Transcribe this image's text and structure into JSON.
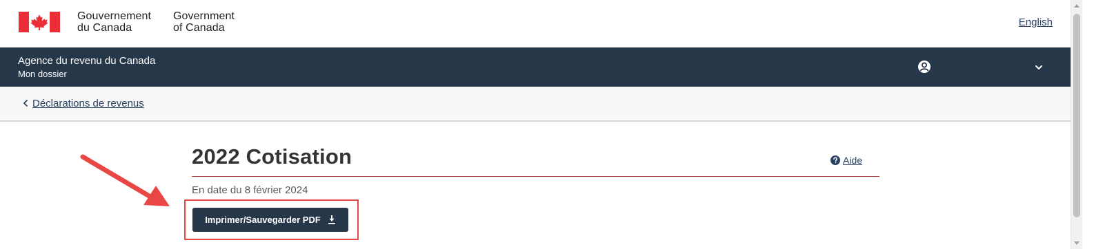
{
  "header": {
    "wordmark_fr_line1": "Gouvernement",
    "wordmark_fr_line2": "du Canada",
    "wordmark_en_line1": "Government",
    "wordmark_en_line2": "of Canada",
    "language_link": "English",
    "flag_icon": "canada-flag-icon"
  },
  "app_bar": {
    "title": "Agence du revenu du Canada",
    "subtitle": "Mon dossier",
    "account_icon": "account-circle-icon",
    "menu_icon": "chevron-down-icon"
  },
  "breadcrumb": {
    "icon": "chevron-left-icon",
    "label": "Déclarations de revenus"
  },
  "page": {
    "title": "2022 Cotisation",
    "help_label": "Aide",
    "help_icon": "question-circle-icon",
    "as_of": "En date du 8 février 2024",
    "print_button_label": "Imprimer/Sauvegarder PDF",
    "print_button_icon": "download-icon"
  },
  "colors": {
    "brand_navy": "#26374a",
    "link": "#284162",
    "title_rule": "#af3c43",
    "flag_red": "#eb2d37",
    "annotation_red": "#e94646"
  }
}
